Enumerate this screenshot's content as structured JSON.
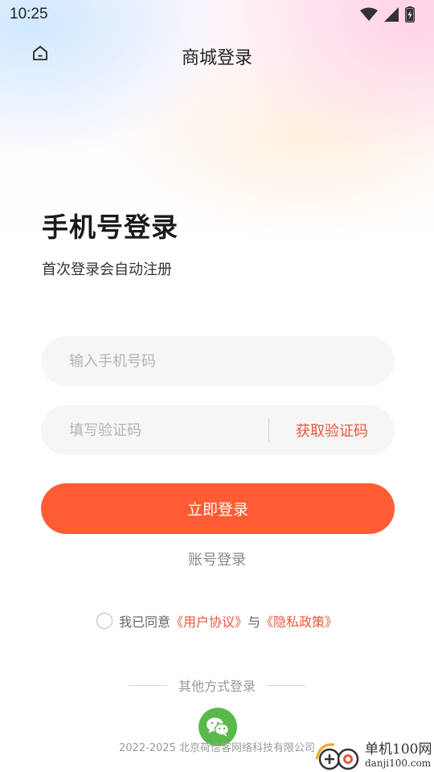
{
  "status_bar": {
    "time": "10:25"
  },
  "nav": {
    "title": "商城登录"
  },
  "heading": "手机号登录",
  "subheading": "首次登录会自动注册",
  "phone_input": {
    "placeholder": "输入手机号码",
    "value": ""
  },
  "code_input": {
    "placeholder": "填写验证码",
    "value": ""
  },
  "get_code_label": "获取验证码",
  "login_button_label": "立即登录",
  "account_login_label": "账号登录",
  "agreement": {
    "prefix": "我已同意",
    "user_agreement": "《用户协议》",
    "conjunction": "与",
    "privacy_policy": "《隐私政策》",
    "checked": false
  },
  "other_login_label": "其他方式登录",
  "other_login_methods": [
    "wechat-icon"
  ],
  "copyright": "2022-2025 北京荷信客网络科技有限公司",
  "watermark": {
    "cn": "单机100网",
    "en": "danji100.com"
  },
  "colors": {
    "accent": "#ff5c33",
    "link": "#e8583a",
    "wechat": "#5ab94c"
  }
}
